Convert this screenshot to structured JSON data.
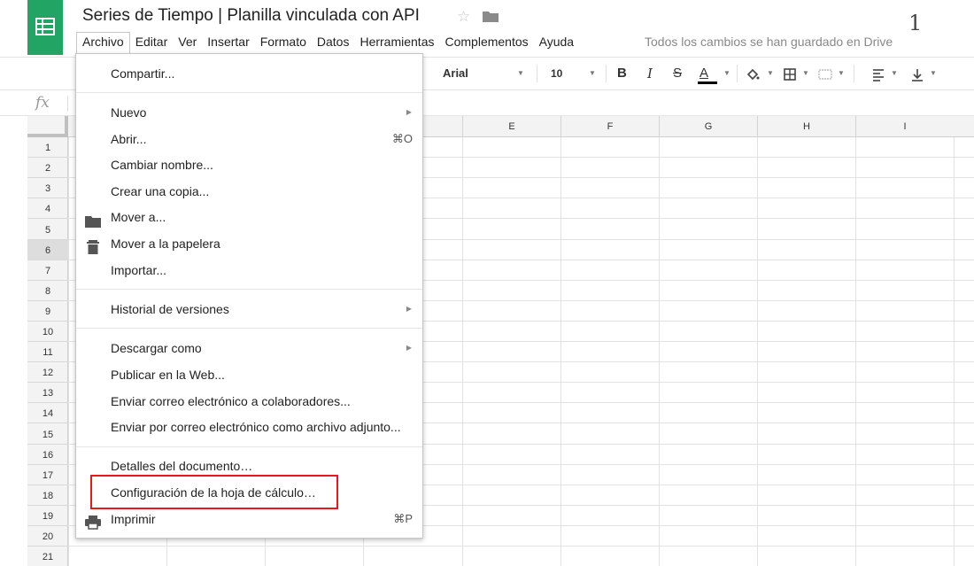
{
  "header": {
    "title": "Series de Tiempo | Planilla vinculada con API",
    "star_glyph": "☆",
    "page_number": "1",
    "saved_status": "Todos los cambios se han guardado en Drive",
    "brand_color": "#21a464"
  },
  "menubar": {
    "items": [
      "Archivo",
      "Editar",
      "Ver",
      "Insertar",
      "Formato",
      "Datos",
      "Herramientas",
      "Complementos",
      "Ayuda"
    ]
  },
  "toolbar": {
    "font": "Arial",
    "font_size": "10",
    "bold": "B",
    "italic": "I",
    "strike": "S",
    "text_color": "A"
  },
  "formula_bar": {
    "fx": "fx"
  },
  "grid": {
    "columns": [
      "E",
      "F",
      "G",
      "H",
      "I"
    ],
    "rows": [
      "1",
      "2",
      "3",
      "4",
      "5",
      "6",
      "7",
      "8",
      "9",
      "10",
      "11",
      "12",
      "13",
      "14",
      "15",
      "16",
      "17",
      "18",
      "19",
      "20",
      "21"
    ],
    "selected_row": "6"
  },
  "file_menu": {
    "share": "Compartir...",
    "new": "Nuevo",
    "open": "Abrir...",
    "open_shortcut": "⌘O",
    "rename": "Cambiar nombre...",
    "copy": "Crear una copia...",
    "move": "Mover a...",
    "trash": "Mover a la papelera",
    "import": "Importar...",
    "history": "Historial de versiones",
    "download": "Descargar como",
    "publish": "Publicar en la Web...",
    "email_collab": "Enviar correo electrónico a colaboradores...",
    "email_attach": "Enviar por correo electrónico como archivo adjunto...",
    "details": "Detalles del documento…",
    "settings": "Configuración de la hoja de cálculo…",
    "print": "Imprimir",
    "print_shortcut": "⌘P",
    "highlight_color": "#e8181b"
  }
}
